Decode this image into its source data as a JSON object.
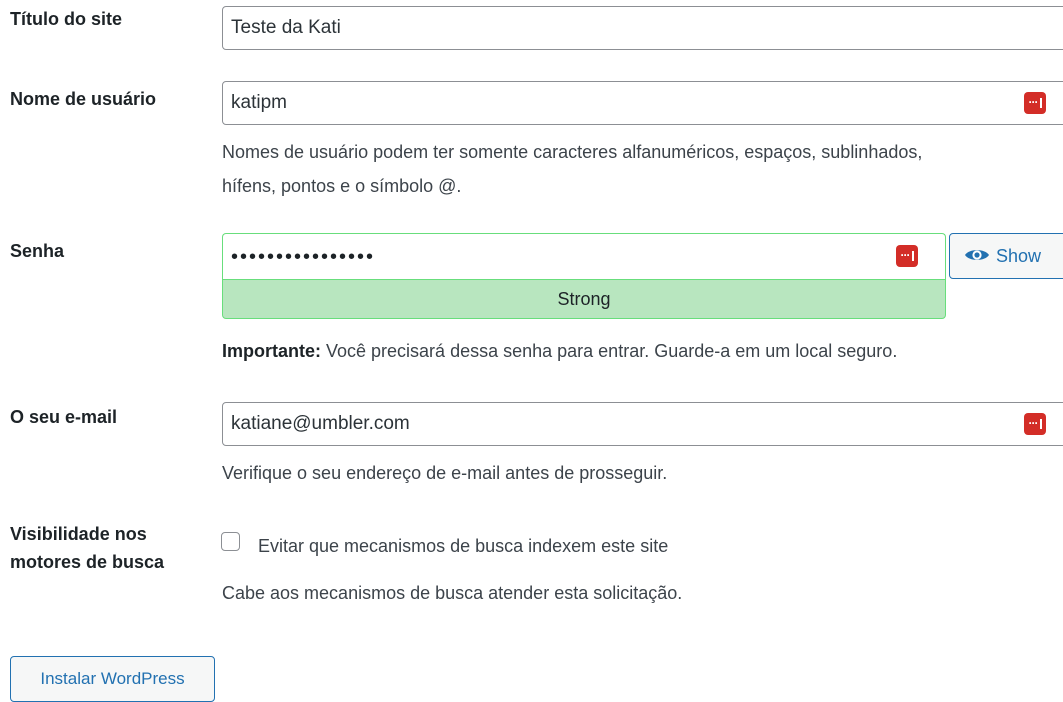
{
  "fields": {
    "site_title": {
      "label": "Título do site",
      "value": "Teste da Kati"
    },
    "username": {
      "label": "Nome de usuário",
      "value": "katipm",
      "help_line1": "Nomes de usuário podem ter somente caracteres alfanuméricos, espaços, sublinhados,",
      "help_line2": "hífens, pontos e o símbolo @."
    },
    "password": {
      "label": "Senha",
      "masked_value": "••••••••••••••••",
      "show_label": "Show",
      "strength": "Strong",
      "note_bold": "Importante:",
      "note_text": " Você precisará dessa senha para entrar. Guarde-a em um local seguro."
    },
    "email": {
      "label": "O seu e-mail",
      "value": "katiane@umbler.com",
      "help": "Verifique o seu endereço de e-mail antes de prosseguir."
    },
    "visibility": {
      "label_line1": "Visibilidade nos",
      "label_line2": "motores de busca",
      "checkbox_label": "Evitar que mecanismos de busca indexem este site",
      "checked": false,
      "help": "Cabe aos mecanismos de busca atender esta solicitação."
    }
  },
  "install_button": "Instalar WordPress",
  "colors": {
    "accent": "#2271b1",
    "password_manager": "#d32d27",
    "strength_bg": "#b8e6bf",
    "strength_border": "#68de7c"
  },
  "icons": [
    "password-manager-icon",
    "eye-icon"
  ]
}
